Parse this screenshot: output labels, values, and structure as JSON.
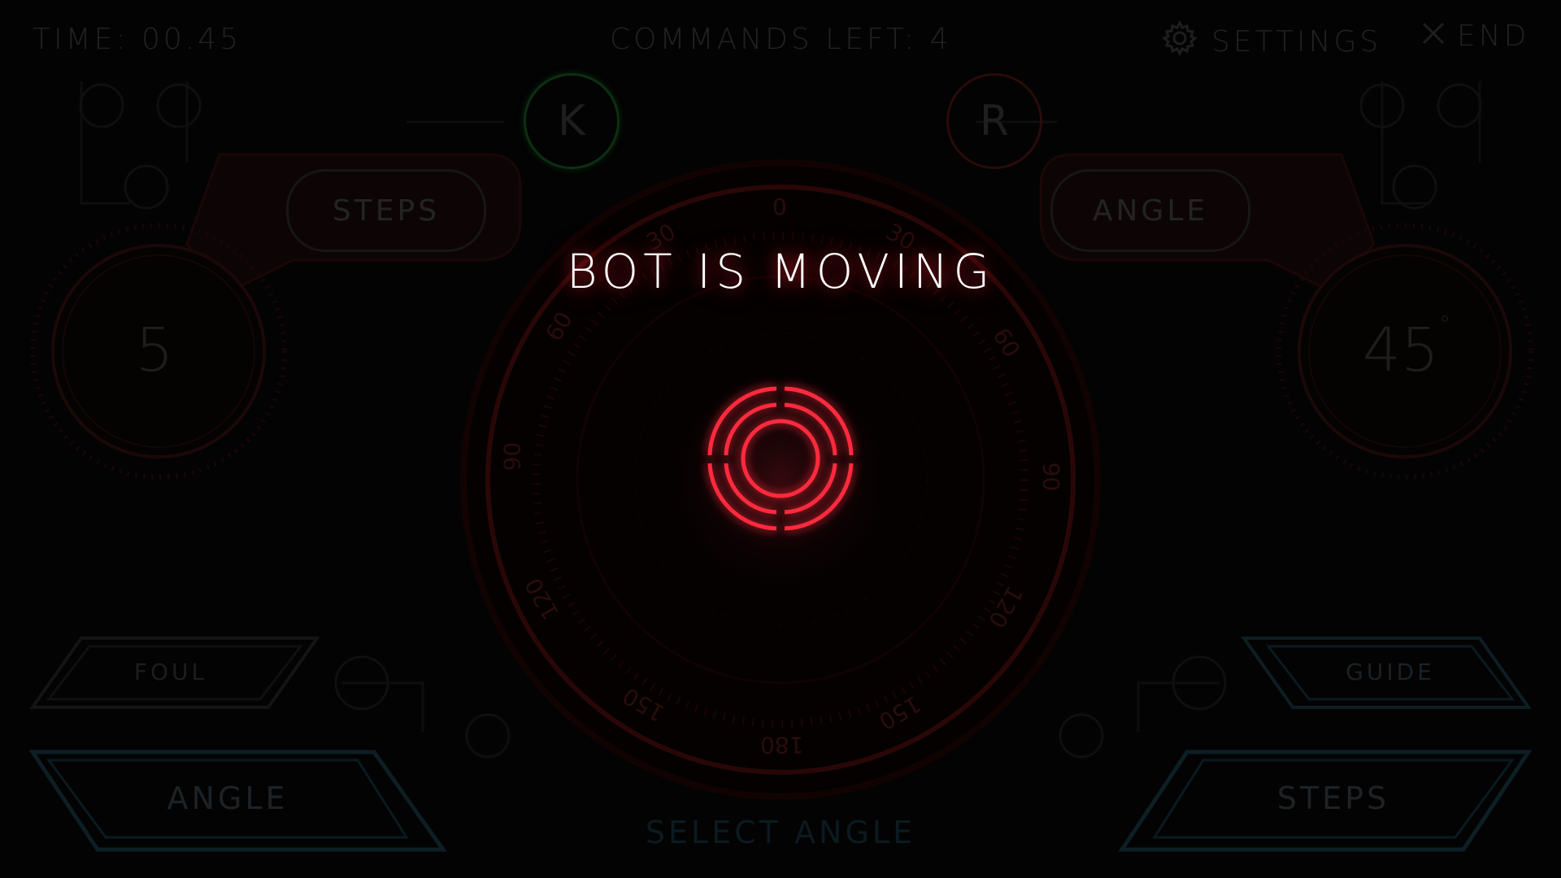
{
  "hud": {
    "time": "TIME: 00.45",
    "commands_left": "COMMANDS LEFT: 4",
    "settings_label": "SETTINGS",
    "end_label": "END"
  },
  "players": {
    "left_badge": "K",
    "right_badge": "R"
  },
  "left_panel": {
    "pill_label": "STEPS",
    "value": "5"
  },
  "right_panel": {
    "pill_label": "ANGLE",
    "value": "45",
    "unit": "°"
  },
  "dial": {
    "ticks": [
      "0",
      "30",
      "30",
      "60",
      "60",
      "90",
      "90",
      "120",
      "120",
      "150",
      "150",
      "180"
    ]
  },
  "overlay": {
    "title": "BOT IS MOVING"
  },
  "buttons": {
    "foul": "FOUL",
    "guide": "GUIDE",
    "angle": "ANGLE",
    "steps": "STEPS",
    "select_angle": "SELECT ANGLE"
  },
  "colors": {
    "accent_red": "#ff2a3c",
    "accent_cyan": "#0f2a33",
    "accent_green": "#0d2f12"
  }
}
